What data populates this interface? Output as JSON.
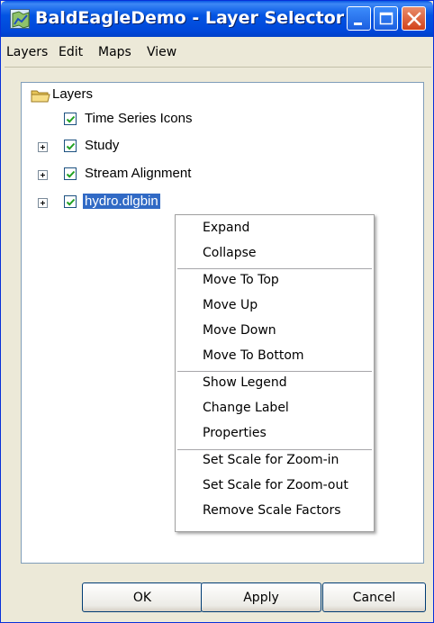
{
  "window": {
    "title": "BaldEagleDemo - Layer Selector"
  },
  "menubar": {
    "items": [
      "Layers",
      "Edit",
      "Maps",
      "View"
    ]
  },
  "tree": {
    "root_label": "Layers",
    "items": [
      {
        "label": "Time Series Icons",
        "checked": true,
        "expandable": false,
        "selected": false
      },
      {
        "label": "Study",
        "checked": true,
        "expandable": true,
        "selected": false
      },
      {
        "label": "Stream Alignment",
        "checked": true,
        "expandable": true,
        "selected": false
      },
      {
        "label": "hydro.dlgbin",
        "checked": true,
        "expandable": true,
        "selected": true
      }
    ]
  },
  "context_menu": {
    "groups": [
      [
        "Expand",
        "Collapse"
      ],
      [
        "Move To Top",
        "Move Up",
        "Move Down",
        "Move To Bottom"
      ],
      [
        "Show Legend",
        "Change Label",
        "Properties"
      ],
      [
        "Set Scale for Zoom-in",
        "Set Scale for Zoom-out",
        "Remove Scale Factors"
      ]
    ]
  },
  "buttons": {
    "ok": "OK",
    "apply": "Apply",
    "cancel": "Cancel"
  },
  "colors": {
    "title_bar": "#0254e3",
    "selection": "#316ac5",
    "close_button": "#d2421a",
    "checkmark": "#21a121"
  },
  "icons": {
    "app": "map-icon",
    "minimize": "minimize-icon",
    "maximize": "maximize-icon",
    "close": "close-icon",
    "root_folder": "folder-icon",
    "expander": "plus-expander-icon",
    "checkbox": "checkbox-checked-icon"
  }
}
